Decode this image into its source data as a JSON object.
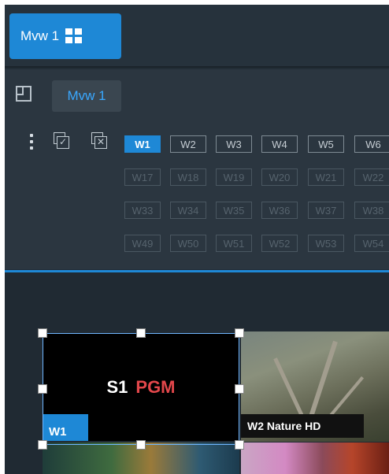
{
  "top_tab": {
    "label": "Mvw 1",
    "icon": "grid-icon"
  },
  "panel": {
    "layout_icon": "layout-edit-icon",
    "chip_label": "Mvw 1",
    "more_icon": "kebab-menu-icon",
    "select_all_icon": "select-all-icon",
    "deselect_all_icon": "deselect-all-icon",
    "window_rows": [
      [
        "W1",
        "W2",
        "W3",
        "W4",
        "W5",
        "W6"
      ],
      [
        "W17",
        "W18",
        "W19",
        "W20",
        "W21",
        "W22"
      ],
      [
        "W33",
        "W34",
        "W35",
        "W36",
        "W37",
        "W38"
      ],
      [
        "W49",
        "W50",
        "W51",
        "W52",
        "W53",
        "W54"
      ]
    ],
    "active_window": "W1"
  },
  "preview": {
    "tile1": {
      "source": "S1",
      "status": "PGM",
      "window_tag": "W1"
    },
    "tile2": {
      "label": "W2 Nature HD"
    }
  },
  "colors": {
    "accent": "#1e88d6",
    "background": "#222d36",
    "panel": "#2b3640",
    "pgm_red": "#e2474b"
  }
}
